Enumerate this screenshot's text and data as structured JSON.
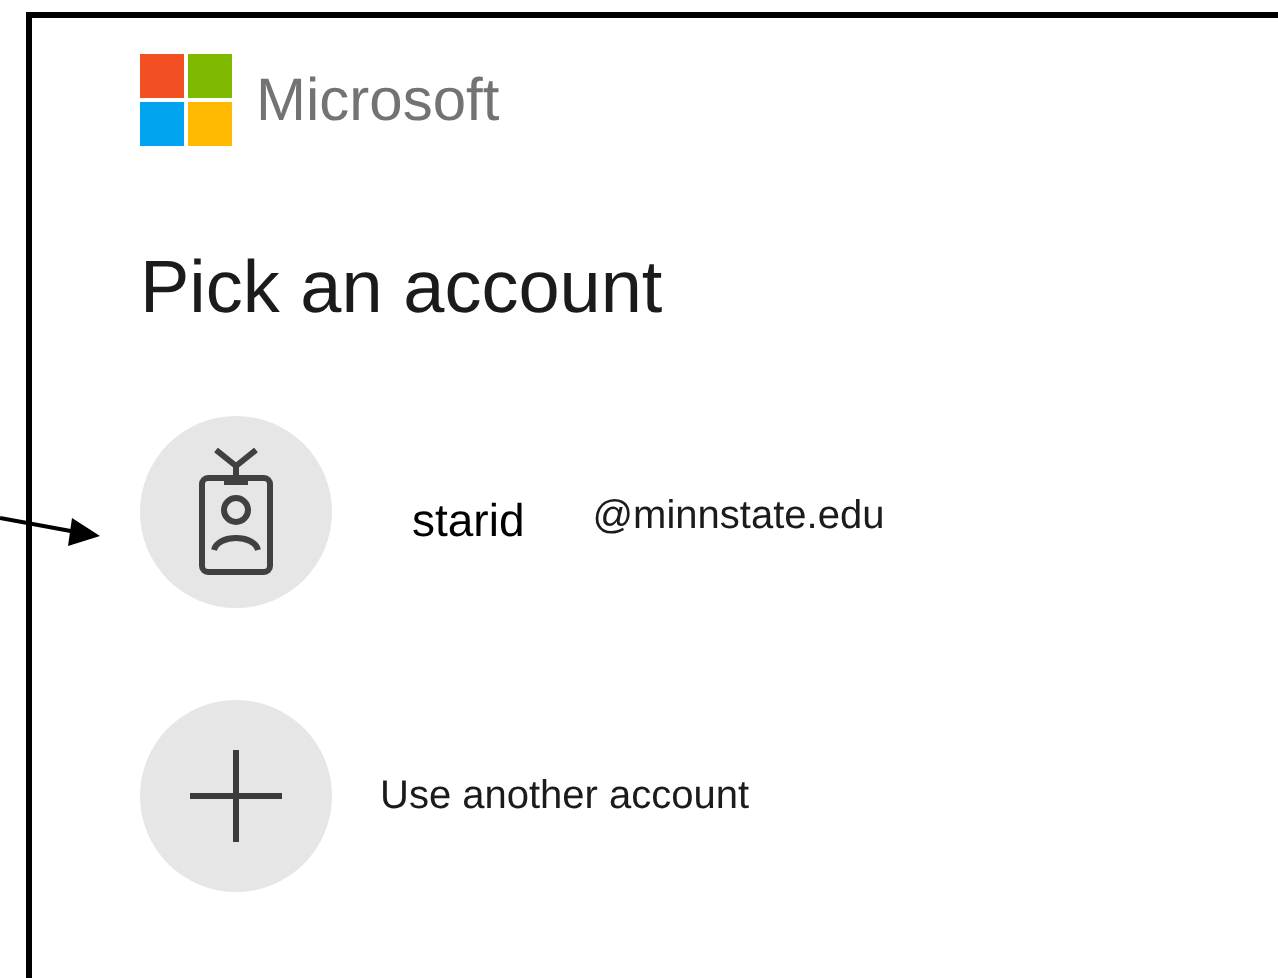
{
  "brand": {
    "name": "Microsoft"
  },
  "heading": "Pick an account",
  "accounts": [
    {
      "kind": "account",
      "annotation": "starid",
      "email": "@minnstate.edu",
      "pointer_arrow": true
    },
    {
      "kind": "add",
      "label": "Use another account"
    }
  ]
}
